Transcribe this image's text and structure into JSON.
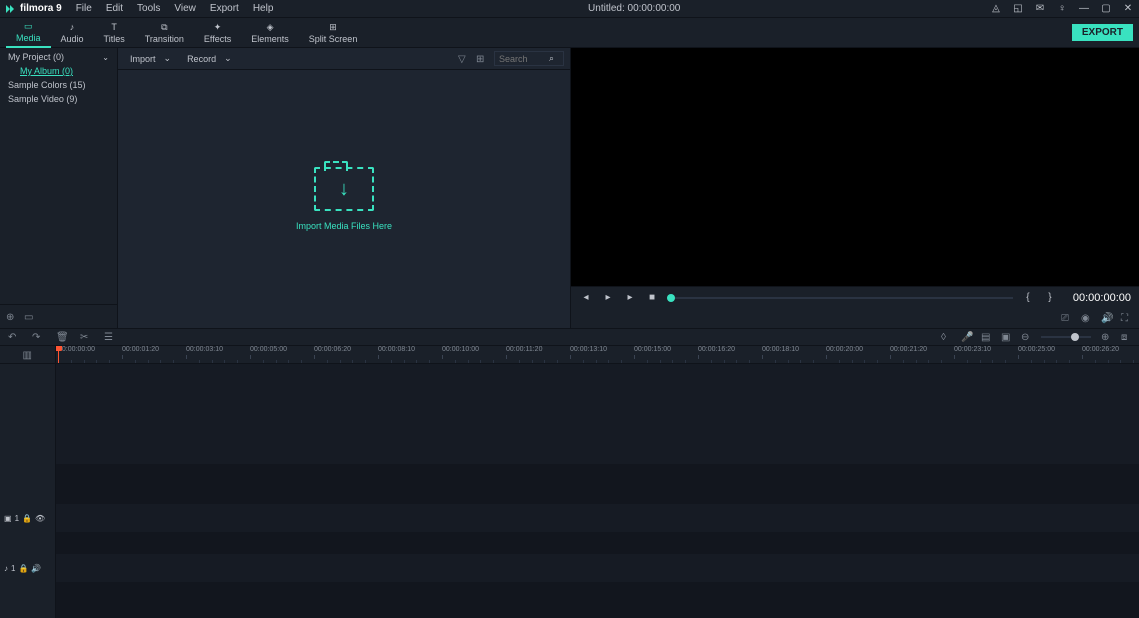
{
  "app": {
    "name": "filmora 9"
  },
  "menu": [
    "File",
    "Edit",
    "Tools",
    "View",
    "Export",
    "Help"
  ],
  "title": {
    "label": "Untitled:",
    "time": "00:00:00:00"
  },
  "tabs": [
    {
      "label": "Media"
    },
    {
      "label": "Audio"
    },
    {
      "label": "Titles"
    },
    {
      "label": "Transition"
    },
    {
      "label": "Effects"
    },
    {
      "label": "Elements"
    },
    {
      "label": "Split Screen"
    }
  ],
  "export_label": "EXPORT",
  "sidebar": {
    "items": [
      {
        "label": "My Project (0)",
        "expandable": true
      },
      {
        "label": "My Album (0)",
        "sub": true
      },
      {
        "label": "Sample Colors (15)"
      },
      {
        "label": "Sample Video (9)"
      }
    ]
  },
  "media_toolbar": {
    "import": "Import",
    "record": "Record",
    "search_placeholder": "Search"
  },
  "import_text": "Import Media Files Here",
  "preview": {
    "time": "00:00:00:00"
  },
  "ruler_ticks": [
    "00:00:00:00",
    "00:00:01:20",
    "00:00:03:10",
    "00:00:05:00",
    "00:00:06:20",
    "00:00:08:10",
    "00:00:10:00",
    "00:00:11:20",
    "00:00:13:10",
    "00:00:15:00",
    "00:00:16:20",
    "00:00:18:10",
    "00:00:20:00",
    "00:00:21:20",
    "00:00:23:10",
    "00:00:25:00",
    "00:00:26:20"
  ],
  "tracks": {
    "video_label": "1",
    "audio_label": "1"
  }
}
